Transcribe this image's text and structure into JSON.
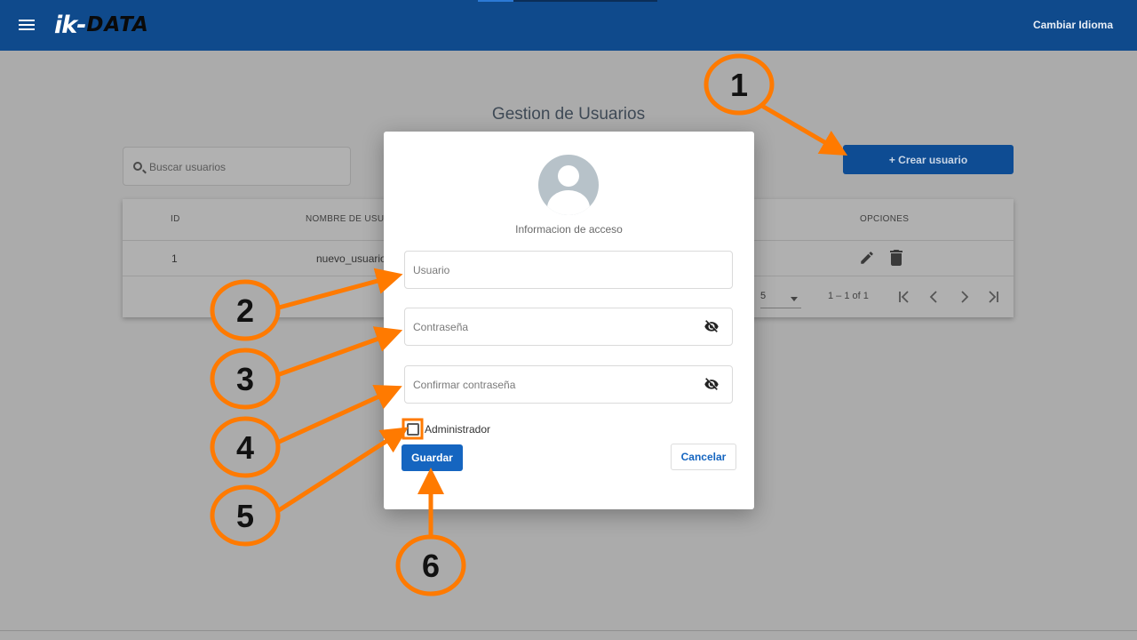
{
  "header": {
    "logo_ik": "ik-",
    "logo_data": "DATA",
    "language_label": "Cambiar Idioma"
  },
  "page": {
    "title": "Gestion de Usuarios",
    "search_placeholder": "Buscar usuarios",
    "create_button": "+ Crear usuario"
  },
  "table": {
    "columns": [
      "ID",
      "NOMBRE DE USUARIO",
      "OPCIONES"
    ],
    "rows": [
      {
        "id": "1",
        "username": "nuevo_usuario"
      }
    ],
    "page_size": "5",
    "range_label": "1 – 1 of 1"
  },
  "modal": {
    "subtitle": "Informacion de acceso",
    "username_placeholder": "Usuario",
    "password_placeholder": "Contraseña",
    "confirm_placeholder": "Confirmar contraseña",
    "admin_label": "Administrador",
    "admin_checked": false,
    "save_label": "Guardar",
    "cancel_label": "Cancelar"
  },
  "annotations": {
    "color": "#ff7a00",
    "markers": [
      "1",
      "2",
      "3",
      "4",
      "5",
      "6"
    ]
  },
  "colors": {
    "header_bg": "#0f4a8c",
    "primary": "#1565c0",
    "overlay_bg": "#ababab"
  }
}
